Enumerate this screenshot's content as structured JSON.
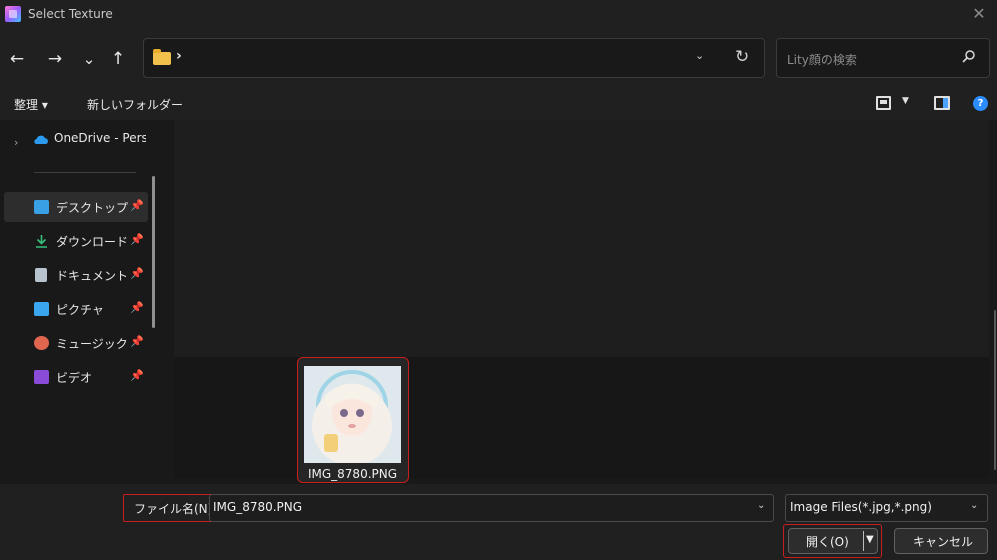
{
  "window": {
    "title": "Select Texture"
  },
  "nav": {
    "back": "←",
    "forward": "→",
    "recent": "⌄",
    "up": "↑"
  },
  "address": {
    "path_chevron": "›",
    "dropdown": "⌄",
    "refresh": "↻"
  },
  "search": {
    "placeholder": "Lity顔の検索"
  },
  "commands": {
    "organize": "整理 ▾",
    "new_folder": "新しいフォルダー"
  },
  "sidebar": {
    "onedrive": "OneDrive - Perso",
    "items": [
      {
        "label": "デスクトップ",
        "icon": "desktop-icon",
        "color": "#3aa0e6"
      },
      {
        "label": "ダウンロード",
        "icon": "download-icon",
        "color": "#36c07a"
      },
      {
        "label": "ドキュメント",
        "icon": "document-icon",
        "color": "#b7c3cf"
      },
      {
        "label": "ピクチャ",
        "icon": "pictures-icon",
        "color": "#3aa6f0"
      },
      {
        "label": "ミュージック",
        "icon": "music-icon",
        "color": "#e0664f"
      },
      {
        "label": "ビデオ",
        "icon": "video-icon",
        "color": "#8a4bd8"
      }
    ],
    "pin": "📌"
  },
  "files": [
    {
      "name": "IMG_8780.PNG"
    }
  ],
  "footer": {
    "filename_label": "ファイル名(N):",
    "filename_value": "IMG_8780.PNG",
    "filetype": "Image Files(*.jpg,*.png)",
    "open_label": "開く(O)",
    "cancel_label": "キャンセル"
  },
  "colors": {
    "highlight_red": "#c81e1e",
    "accent_blue": "#2a8cff"
  }
}
